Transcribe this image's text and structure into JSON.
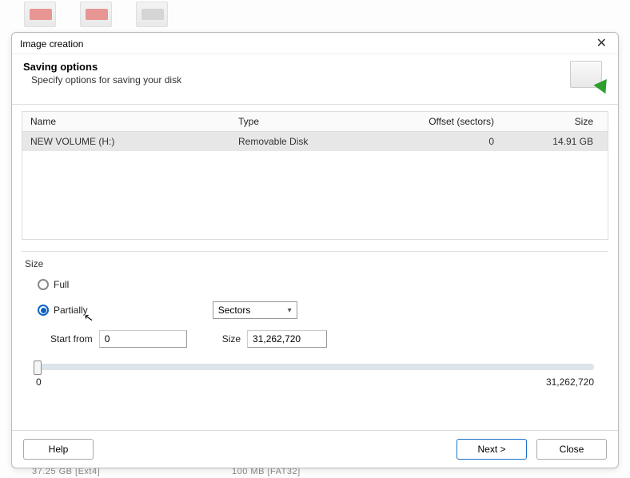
{
  "background": {
    "row_text_1": "37.25 GB [Ext4]",
    "row_text_2": "100 MB [FAT32]"
  },
  "dialog": {
    "title": "Image creation",
    "heading": "Saving options",
    "subheading": "Specify options for saving your disk",
    "table": {
      "headers": {
        "name": "Name",
        "type": "Type",
        "offset": "Offset (sectors)",
        "size": "Size"
      },
      "row": {
        "name": "NEW VOLUME (H:)",
        "type": "Removable Disk",
        "offset": "0",
        "size": "14.91 GB"
      }
    },
    "size_section": {
      "label": "Size",
      "full_label": "Full",
      "partially_label": "Partially",
      "unit_options": [
        "Sectors"
      ],
      "unit_selected": "Sectors",
      "start_label": "Start from",
      "start_value": "0",
      "size_label": "Size",
      "size_value": "31,262,720",
      "slider_min": "0",
      "slider_max": "31,262,720"
    },
    "buttons": {
      "help": "Help",
      "next": "Next >",
      "close": "Close"
    }
  }
}
